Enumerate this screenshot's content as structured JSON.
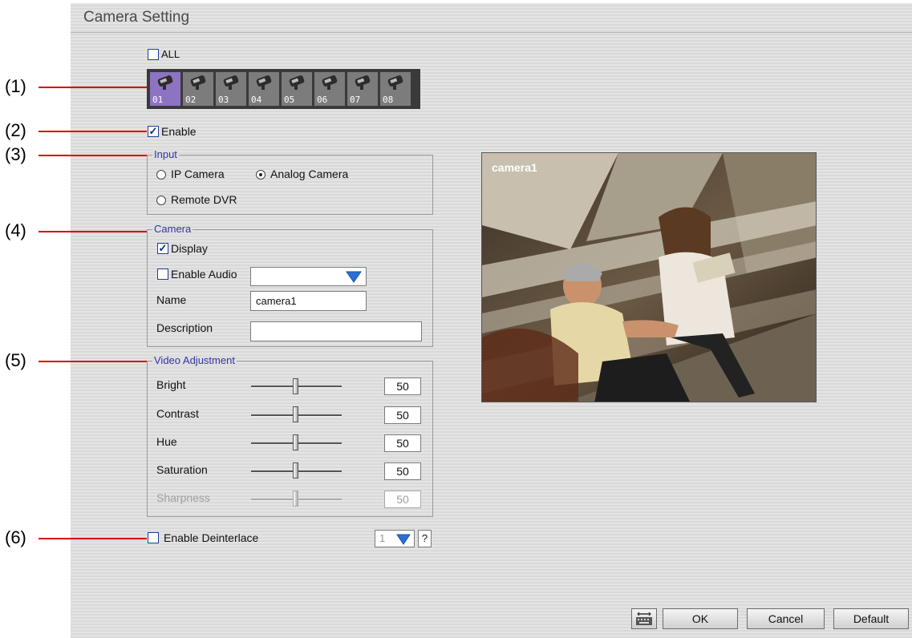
{
  "title": "Camera Setting",
  "all_label": "ALL",
  "cameras": [
    "01",
    "02",
    "03",
    "04",
    "05",
    "06",
    "07",
    "08"
  ],
  "callouts": [
    "(1)",
    "(2)",
    "(3)",
    "(4)",
    "(5)",
    "(6)"
  ],
  "enable_label": "Enable",
  "input": {
    "group_title": "Input",
    "ip_camera": "IP Camera",
    "analog_camera": "Analog Camera",
    "remote_dvr": "Remote DVR",
    "selected": "Analog Camera"
  },
  "camera": {
    "group_title": "Camera",
    "display_label": "Display",
    "enable_audio_label": "Enable Audio",
    "name_label": "Name",
    "name_value": "camera1",
    "description_label": "Description",
    "description_value": ""
  },
  "video": {
    "group_title": "Video Adjustment",
    "bright_label": "Bright",
    "bright_value": "50",
    "contrast_label": "Contrast",
    "contrast_value": "50",
    "hue_label": "Hue",
    "hue_value": "50",
    "saturation_label": "Saturation",
    "saturation_value": "50",
    "sharpness_label": "Sharpness",
    "sharpness_value": "50"
  },
  "deinterlace": {
    "label": "Enable Deinterlace",
    "value": "1",
    "help": "?"
  },
  "preview_label": "camera1",
  "buttons": {
    "ok": "OK",
    "cancel": "Cancel",
    "default": "Default"
  },
  "colors": {
    "accent": "#d90000",
    "selected_camera": "#8d74c2",
    "group_title": "#3333aa"
  }
}
